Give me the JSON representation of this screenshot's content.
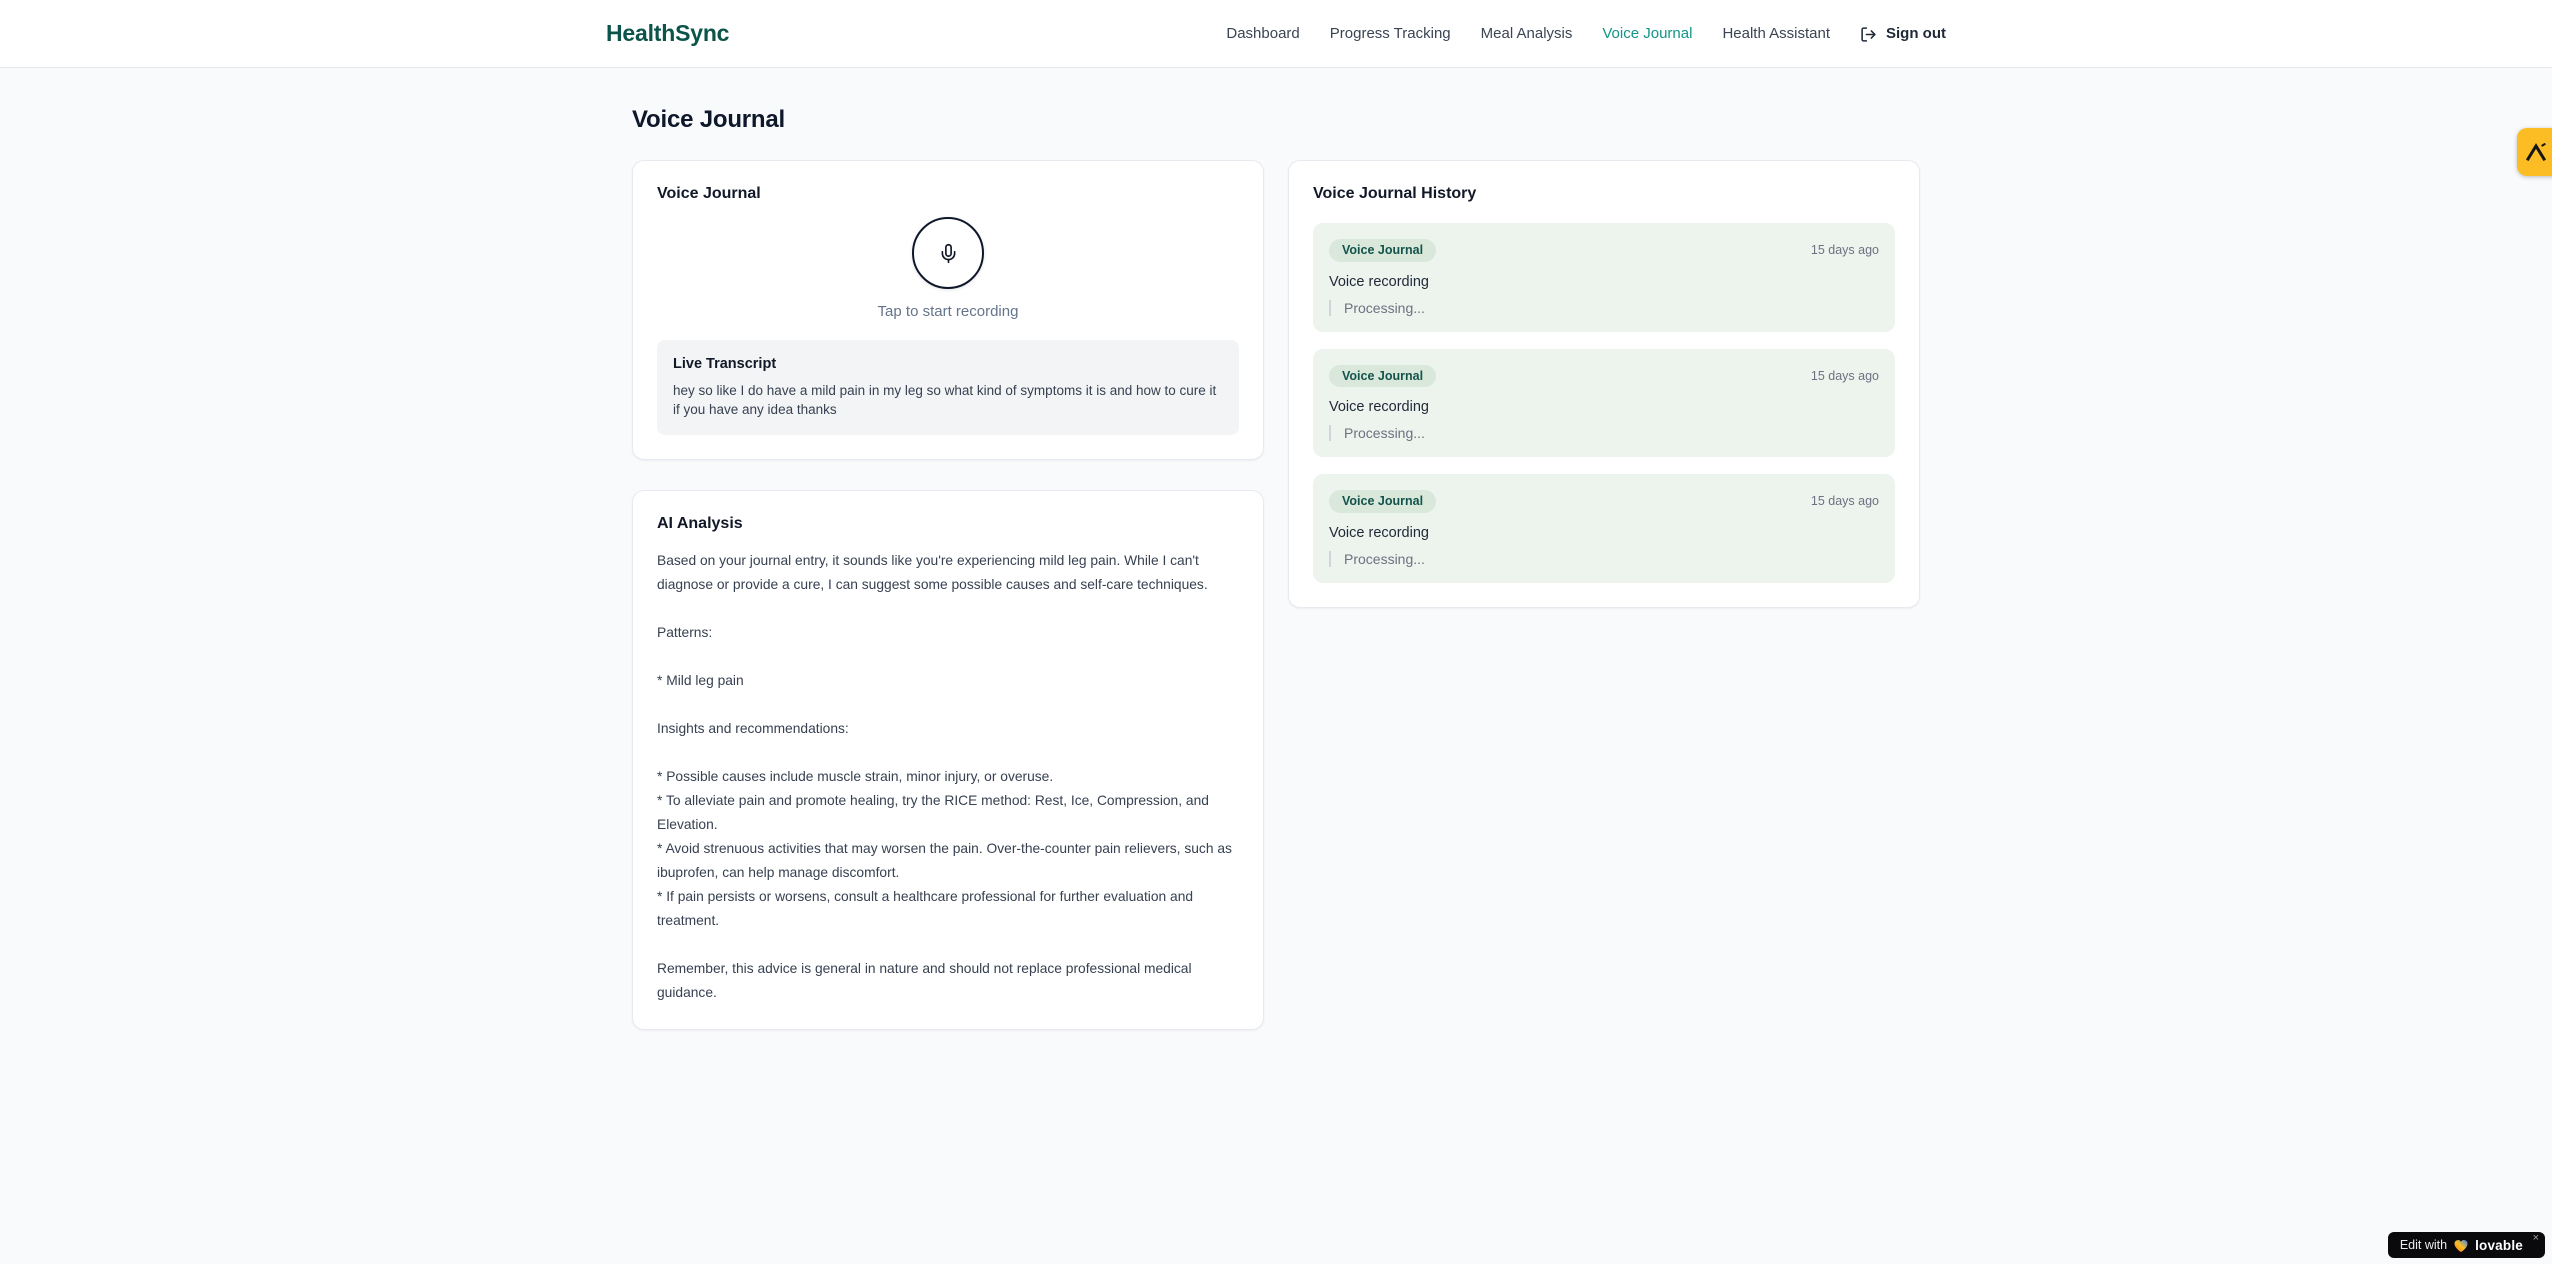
{
  "brand": {
    "name": "HealthSync"
  },
  "nav": {
    "items": [
      {
        "label": "Dashboard",
        "active": false
      },
      {
        "label": "Progress Tracking",
        "active": false
      },
      {
        "label": "Meal Analysis",
        "active": false
      },
      {
        "label": "Voice Journal",
        "active": true
      },
      {
        "label": "Health Assistant",
        "active": false
      }
    ],
    "sign_out": "Sign out"
  },
  "page": {
    "title": "Voice Journal"
  },
  "recorder_card": {
    "title": "Voice Journal",
    "tap_hint": "Tap to start recording",
    "live_transcript_label": "Live Transcript",
    "transcript": "hey so like I do have a mild pain in my leg so what kind of symptoms it is and how to cure it if you have any idea thanks"
  },
  "analysis_card": {
    "title": "AI Analysis",
    "body": "Based on your journal entry, it sounds like you're experiencing mild leg pain. While I can't diagnose or provide a cure, I can suggest some possible causes and self-care techniques.\n\nPatterns:\n\n* Mild leg pain\n\nInsights and recommendations:\n\n* Possible causes include muscle strain, minor injury, or overuse.\n* To alleviate pain and promote healing, try the RICE method: Rest, Ice, Compression, and Elevation.\n* Avoid strenuous activities that may worsen the pain. Over-the-counter pain relievers, such as ibuprofen, can help manage discomfort.\n* If pain persists or worsens, consult a healthcare professional for further evaluation and treatment.\n\nRemember, this advice is general in nature and should not replace professional medical guidance."
  },
  "history_card": {
    "title": "Voice Journal History",
    "items": [
      {
        "badge": "Voice Journal",
        "time": "15 days ago",
        "title": "Voice recording",
        "status": "Processing..."
      },
      {
        "badge": "Voice Journal",
        "time": "15 days ago",
        "title": "Voice recording",
        "status": "Processing..."
      },
      {
        "badge": "Voice Journal",
        "time": "15 days ago",
        "title": "Voice recording",
        "status": "Processing..."
      }
    ]
  },
  "overlays": {
    "edit_badge": {
      "prefix": "Edit with",
      "brand": "lovable",
      "close": "×"
    }
  },
  "icons": {
    "microphone": "mic-icon",
    "sign_out": "log-out-icon",
    "heart": "heart-icon",
    "close": "close-icon",
    "side_logo": "caret-logo-icon"
  },
  "colors": {
    "brand_green": "#0c5449",
    "nav_active_teal": "#119488",
    "page_bg": "#f8fafc",
    "history_item_bg": "#edf4ee",
    "history_badge_bg": "#d9e8db",
    "history_badge_text": "#14534b",
    "floating_button_amber": "#fbbd23",
    "edit_badge_bg": "#0a0a0c"
  }
}
